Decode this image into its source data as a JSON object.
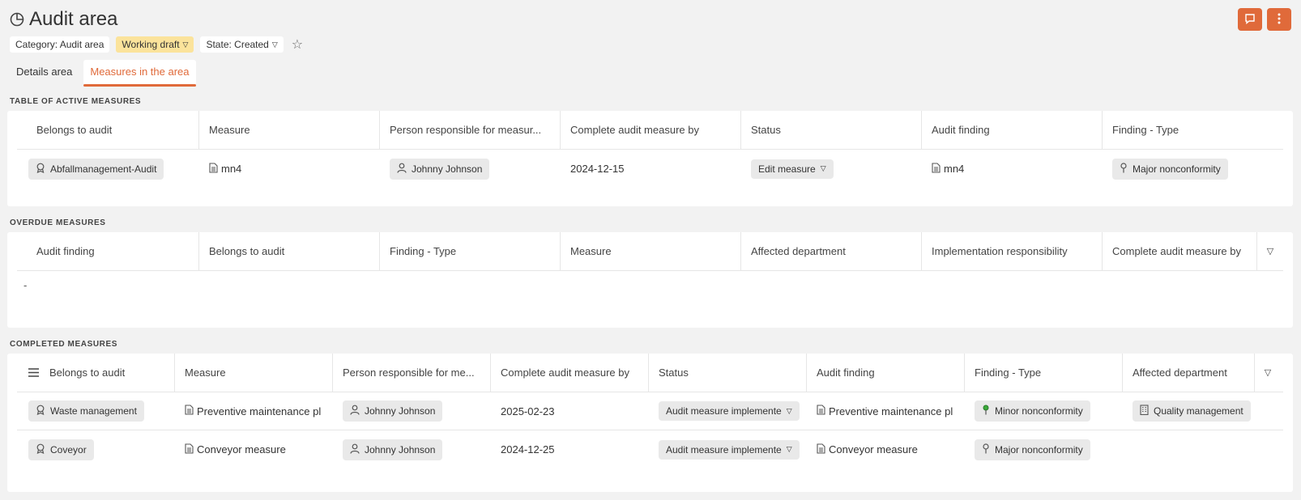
{
  "page": {
    "title": "Audit area",
    "category_chip": "Category: Audit area",
    "draft_chip": "Working draft",
    "state_chip": "State: Created"
  },
  "tabs": [
    {
      "label": "Details area"
    },
    {
      "label": "Measures in the area"
    }
  ],
  "active_measures": {
    "label": "TABLE OF ACTIVE MEASURES",
    "columns": [
      "Belongs to audit",
      "Measure",
      "Person responsible for measur...",
      "Complete audit measure by",
      "Status",
      "Audit finding",
      "Finding - Type"
    ],
    "rows": [
      {
        "audit": "Abfallmanagement-Audit",
        "measure": "mn4",
        "person": "Johnny Johnson",
        "date": "2024-12-15",
        "status": "Edit measure",
        "finding": "mn4",
        "finding_type": "Major nonconformity"
      }
    ]
  },
  "overdue_measures": {
    "label": "OVERDUE MEASURES",
    "columns": [
      "Audit finding",
      "Belongs to audit",
      "Finding - Type",
      "Measure",
      "Affected department",
      "Implementation responsibility",
      "Complete audit measure by"
    ],
    "empty_text": "-"
  },
  "completed_measures": {
    "label": "COMPLETED MEASURES",
    "columns": [
      "Belongs to audit",
      "Measure",
      "Person responsible for me...",
      "Complete audit measure by",
      "Status",
      "Audit finding",
      "Finding - Type",
      "Affected department"
    ],
    "rows": [
      {
        "audit": "Waste management",
        "measure": "Preventive maintenance pl",
        "person": "Johnny Johnson",
        "date": "2025-02-23",
        "status": "Audit measure implemente",
        "finding": "Preventive maintenance pl",
        "finding_type": "Minor nonconformity",
        "department": "Quality management"
      },
      {
        "audit": "Coveyor",
        "measure": "Conveyor measure",
        "person": "Johnny Johnson",
        "date": "2024-12-25",
        "status": "Audit measure implemente",
        "finding": "Conveyor measure",
        "finding_type": "Major nonconformity",
        "department": ""
      }
    ]
  },
  "colors": {
    "accent": "#e06a3a",
    "draft": "#fbe39b",
    "minor_icon": "#3aaa3a"
  }
}
